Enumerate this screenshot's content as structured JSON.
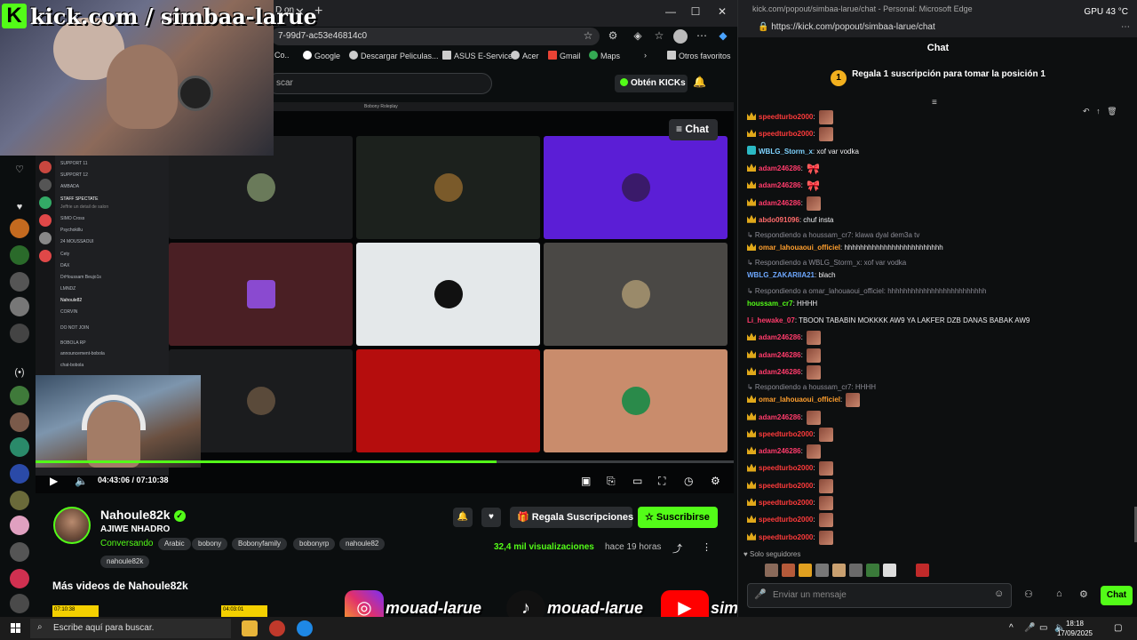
{
  "left_browser": {
    "tab_title": "D on",
    "address": "7-99d7-ac53e46814c0",
    "bookmarks": [
      "Co..",
      "Google",
      "Descargar Peliculas...",
      "ASUS E-Service",
      "Acer",
      "Gmail",
      "Maps",
      "Otros favoritos"
    ],
    "search_placeholder": "scar",
    "obten_label": "Obtén KICKs",
    "chat_overlay_label": "≡ Chat",
    "kick_overlay_text": "kick.com / simbaa-larue",
    "kick_logo_letter": "K",
    "player": {
      "timecode": "04:43:06 / 07:10:38",
      "progress_fraction": 0.66
    },
    "inner_topbar_text": "Bobony Roleplay",
    "discord_lines": [
      "SUPPORT 11",
      "SUPPORT 12",
      "AMBADA",
      "STAFF SPECTATE",
      "Jeffrie un detail de salon",
      "SIMO Cross",
      "Psychokillu",
      "24 MOUSSAOUI",
      "Cety",
      "DAX",
      "DrHoussam Beujo1s",
      "LMNDZ",
      "Nahoule82",
      "CORVIN",
      "DO NOT JOIN",
      "BOBOLA RP",
      "announcement-bobola",
      "chat-bobola"
    ]
  },
  "channel": {
    "name": "Nahoule82k",
    "title": "AJIWE NHADRO",
    "category": "Conversando",
    "tags": [
      "Arabic",
      "bobony",
      "Bobonyfamily",
      "bobonyrp",
      "nahoule82",
      "nahoule82k"
    ],
    "views": "32,4 mil visualizaciones",
    "ago": "hace 19 horas",
    "gift_label": "Regala Suscripciones",
    "subscribe_label": "Suscribirse",
    "more_videos": "Más videos de Nahoule82k",
    "thumb_times": [
      "07:10:38",
      "04:03:01"
    ]
  },
  "socials": [
    {
      "name": "instagram",
      "handle": "mouad-larue",
      "color": "#e1306c"
    },
    {
      "name": "tiktok",
      "handle": "mouad-larue",
      "color": "#111111"
    },
    {
      "name": "youtube",
      "handle": "simbaa-larue",
      "color": "#ff0000"
    }
  ],
  "chat_window": {
    "title": "kick.com/popout/simbaa-larue/chat - Personal: Microsoft Edge",
    "gpu": "GPU  43 °C",
    "url": "https://kick.com/popout/simbaa-larue/chat",
    "header": "Chat",
    "promo_rank": "1",
    "promo_text": "Regala 1 suscripción para tomar la posición 1",
    "messages": [
      {
        "kind": "msg",
        "badge": "crown",
        "user": "speedturbo2000",
        "color": "#ff3b3b",
        "text": "",
        "emote": "face"
      },
      {
        "kind": "msg",
        "badge": "crown",
        "user": "speedturbo2000",
        "color": "#ff3b3b",
        "text": "",
        "emote": "face"
      },
      {
        "kind": "msg",
        "badge": "teal",
        "user": "WBLG_Storm_x",
        "color": "#7fd3ff",
        "text": "xof var vodka",
        "emote": ""
      },
      {
        "kind": "msg",
        "badge": "crown",
        "user": "adam246286",
        "color": "#ff3b6b",
        "text": "",
        "emote": "pink"
      },
      {
        "kind": "msg",
        "badge": "crown",
        "user": "adam246286",
        "color": "#ff3b6b",
        "text": "",
        "emote": "pink"
      },
      {
        "kind": "msg",
        "badge": "crown",
        "user": "adam246286",
        "color": "#ff3b6b",
        "text": "",
        "emote": "face"
      },
      {
        "kind": "msg",
        "badge": "crown",
        "user": "abdo091096",
        "color": "#ff6b6b",
        "text": "chuf insta",
        "emote": ""
      },
      {
        "kind": "reply",
        "text": "↳ Respondiendo a houssam_cr7: klawa dyal dem3a tv"
      },
      {
        "kind": "msg",
        "badge": "crown",
        "user": "omar_lahouaoui_officiel",
        "color": "#ff9f2e",
        "text": "hhhhhhhhhhhhhhhhhhhhhhhhh",
        "emote": ""
      },
      {
        "kind": "reply",
        "text": "↳ Respondiendo a WBLG_Storm_x: xof var vodka"
      },
      {
        "kind": "msg",
        "badge": "",
        "user": "WBLG_ZAKARIIA21",
        "color": "#6ea8ff",
        "text": "blach",
        "emote": ""
      },
      {
        "kind": "reply",
        "text": "↳ Respondiendo a omar_lahouaoui_officiel: hhhhhhhhhhhhhhhhhhhhhhhhh"
      },
      {
        "kind": "msg",
        "badge": "",
        "user": "houssam_cr7",
        "color": "#53fc18",
        "text": "HHHH",
        "emote": ""
      },
      {
        "kind": "msg",
        "badge": "",
        "user": "Li_hewake_07",
        "color": "#ff3b6b",
        "text": "TBOON TABABIN MOKKKK AW9 YA LAKFER DZB DANAS BABAK AW9",
        "emote": ""
      },
      {
        "kind": "msg",
        "badge": "crown",
        "user": "adam246286",
        "color": "#ff3b6b",
        "text": "",
        "emote": "face"
      },
      {
        "kind": "msg",
        "badge": "crown",
        "user": "adam246286",
        "color": "#ff3b6b",
        "text": "",
        "emote": "face"
      },
      {
        "kind": "msg",
        "badge": "crown",
        "user": "adam246286",
        "color": "#ff3b6b",
        "text": "",
        "emote": "face"
      },
      {
        "kind": "reply",
        "text": "↳ Respondiendo a houssam_cr7: HHHH"
      },
      {
        "kind": "msg",
        "badge": "crown",
        "user": "omar_lahouaoui_officiel",
        "color": "#ff9f2e",
        "text": "",
        "emote": "face"
      },
      {
        "kind": "msg",
        "badge": "crown",
        "user": "adam246286",
        "color": "#ff3b6b",
        "text": "",
        "emote": "face"
      },
      {
        "kind": "msg",
        "badge": "crown",
        "user": "speedturbo2000",
        "color": "#ff3b3b",
        "text": "",
        "emote": "face"
      },
      {
        "kind": "msg",
        "badge": "crown",
        "user": "adam246286",
        "color": "#ff3b6b",
        "text": "",
        "emote": "face"
      },
      {
        "kind": "msg",
        "badge": "crown",
        "user": "speedturbo2000",
        "color": "#ff3b3b",
        "text": "",
        "emote": "face"
      },
      {
        "kind": "msg",
        "badge": "crown",
        "user": "speedturbo2000",
        "color": "#ff3b3b",
        "text": "",
        "emote": "face"
      },
      {
        "kind": "msg",
        "badge": "crown",
        "user": "speedturbo2000",
        "color": "#ff3b3b",
        "text": "",
        "emote": "face"
      },
      {
        "kind": "msg",
        "badge": "crown",
        "user": "speedturbo2000",
        "color": "#ff3b3b",
        "text": "",
        "emote": "face"
      },
      {
        "kind": "msg",
        "badge": "crown",
        "user": "speedturbo2000",
        "color": "#ff3b3b",
        "text": "",
        "emote": "face"
      }
    ],
    "followers_only": "Solo seguidores",
    "input_placeholder": "Enviar un mensaje",
    "send_label": "Chat"
  },
  "taskbar": {
    "search_placeholder": "Escribe aquí para buscar.",
    "time": "18:18",
    "date": "17/09/2025"
  },
  "colors": {
    "kick_green": "#53fc18"
  }
}
